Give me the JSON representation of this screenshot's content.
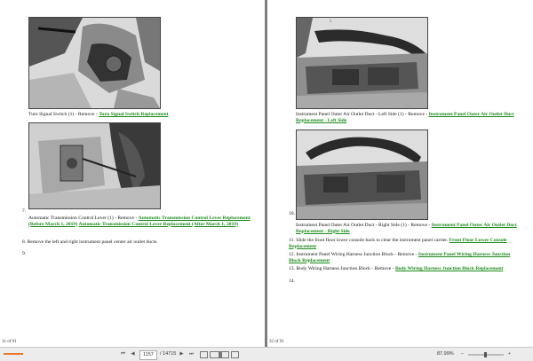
{
  "left_page": {
    "steps": [
      {
        "text": "Turn Signal Switch (1) - Remove - ",
        "link": "Turn Signal Switch Replacement"
      },
      {
        "number": "7.",
        "text": "Automatic Transmission Control Lever (1) - Remove - ",
        "link": "Automatic Transmission Control Lever Replacement (Before March 1, 2019)",
        "joiner": " ",
        "link2": "Automatic Transmission Control Lever Replacement (After March 1, 2019)"
      },
      {
        "number": "8.",
        "text": "Remove the left and right instrument panel center air outlet ducts."
      },
      {
        "number": "9."
      }
    ],
    "page_num": "31 of 91"
  },
  "right_page": {
    "callout": "1",
    "steps": [
      {
        "text": "Instrument Panel Outer Air Outlet Duct - Left Side (1) - Remove - ",
        "link": "Instrument Panel Outer Air Outlet Duct Replacement - Left Side"
      },
      {
        "number": "10.",
        "text": "Instrument Panel Outer Air Outlet Duct - Right Side (1) - Remove - ",
        "link": "Instrument Panel Outer Air Outlet Duct Replacement - Right Side"
      },
      {
        "number": "11.",
        "text": "Slide the front floor lower console back to clear the instrument panel carrier. ",
        "link": "Front Floor Lower Console Replacement"
      },
      {
        "number": "12.",
        "text": "Instrument Panel Wiring Harness Junction Block - Remove - ",
        "link": "Instrument Panel Wiring Harness Junction Block Replacement"
      },
      {
        "number": "13.",
        "text": "Body Wiring Harness Junction Block - Remove - ",
        "link": "Body Wiring Harness Junction Block Replacement"
      },
      {
        "number": "14."
      }
    ],
    "page_num": "32 of 91"
  },
  "statusbar": {
    "current_page": "1157",
    "total_pages": "/ 14715",
    "zoom": "87.99%",
    "zoom_minus": "–",
    "zoom_plus": "+",
    "first": "⏮",
    "prev": "◀",
    "next": "▶",
    "last": "⏭"
  }
}
